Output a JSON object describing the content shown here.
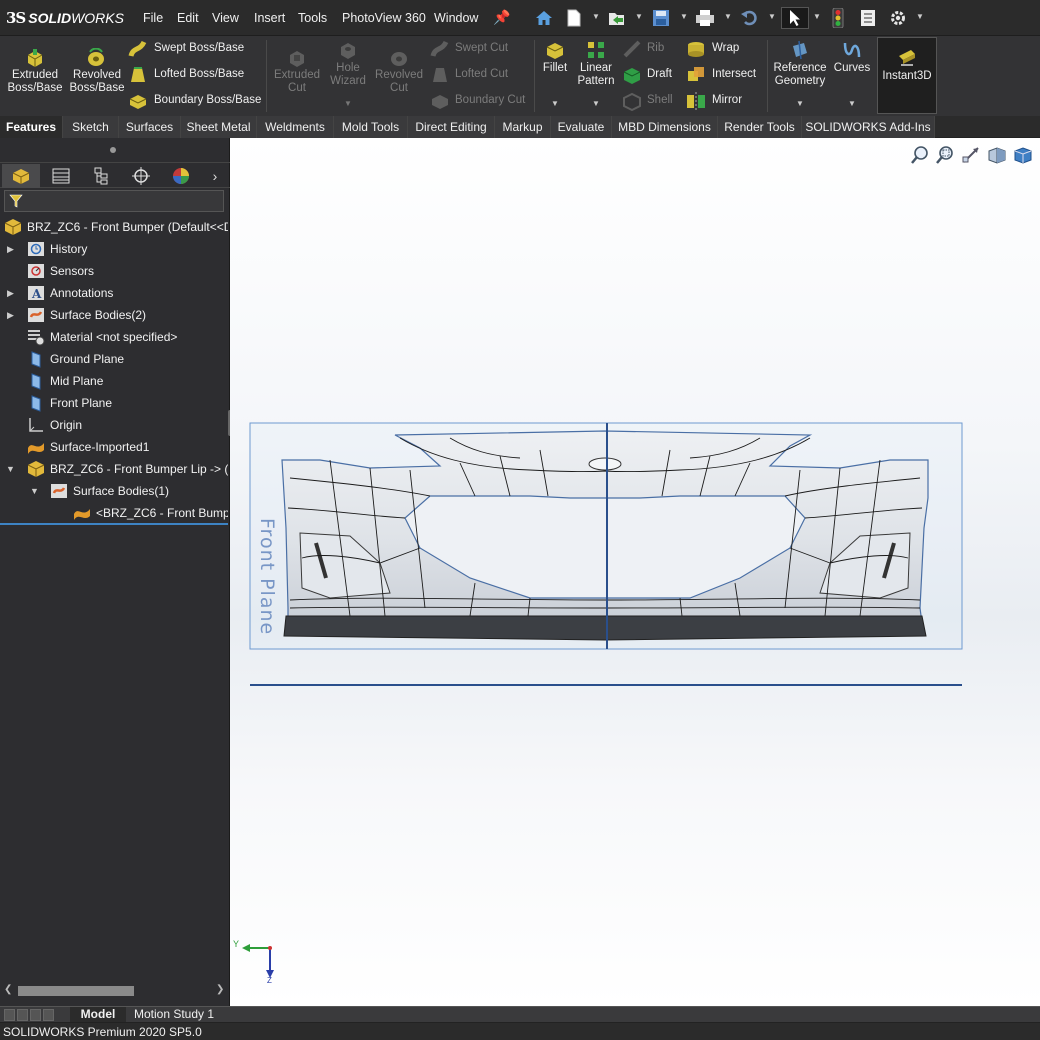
{
  "app": {
    "brand_solid": "SOLID",
    "brand_works": "WORKS",
    "brand_ds": "3S"
  },
  "menu": [
    "File",
    "Edit",
    "View",
    "Insert",
    "Tools",
    "PhotoView 360",
    "Window"
  ],
  "ribbon": {
    "extruded_boss": "Extruded\nBoss/Base",
    "revolved_boss": "Revolved\nBoss/Base",
    "swept_boss": "Swept Boss/Base",
    "lofted_boss": "Lofted Boss/Base",
    "boundary_boss": "Boundary Boss/Base",
    "extruded_cut": "Extruded\nCut",
    "hole_wizard": "Hole\nWizard",
    "revolved_cut": "Revolved\nCut",
    "swept_cut": "Swept Cut",
    "lofted_cut": "Lofted Cut",
    "boundary_cut": "Boundary Cut",
    "fillet": "Fillet",
    "linear_pattern": "Linear\nPattern",
    "rib": "Rib",
    "draft": "Draft",
    "shell": "Shell",
    "wrap": "Wrap",
    "intersect": "Intersect",
    "mirror": "Mirror",
    "reference_geometry": "Reference\nGeometry",
    "curves": "Curves",
    "instant3d": "Instant3D"
  },
  "tabs": [
    "Features",
    "Sketch",
    "Surfaces",
    "Sheet Metal",
    "Weldments",
    "Mold Tools",
    "Direct Editing",
    "Markup",
    "Evaluate",
    "MBD Dimensions",
    "Render Tools",
    "SOLIDWORKS Add-Ins"
  ],
  "tree": {
    "root": "BRZ_ZC6 - Front Bumper  (Default<<D",
    "items": [
      {
        "label": "History",
        "expandable": true
      },
      {
        "label": "Sensors",
        "expandable": false
      },
      {
        "label": "Annotations",
        "expandable": true
      },
      {
        "label": "Surface Bodies(2)",
        "expandable": true
      },
      {
        "label": "Material <not specified>",
        "expandable": false
      },
      {
        "label": "Ground Plane",
        "expandable": false
      },
      {
        "label": "Mid Plane",
        "expandable": false
      },
      {
        "label": "Front Plane",
        "expandable": false
      },
      {
        "label": "Origin",
        "expandable": false
      },
      {
        "label": "Surface-Imported1",
        "expandable": false
      },
      {
        "label": "BRZ_ZC6 - Front Bumper Lip -> (D",
        "expandable": true
      },
      {
        "label": "Surface Bodies(1)",
        "expandable": true
      },
      {
        "label": "<BRZ_ZC6 - Front Bumpe",
        "expandable": false
      }
    ]
  },
  "viewport": {
    "plane_label": "Front Plane",
    "triad_y": "Y",
    "triad_z": "Z"
  },
  "bottom_tabs": [
    "Model",
    "Motion Study 1"
  ],
  "status": "SOLIDWORKS Premium 2020 SP5.0"
}
